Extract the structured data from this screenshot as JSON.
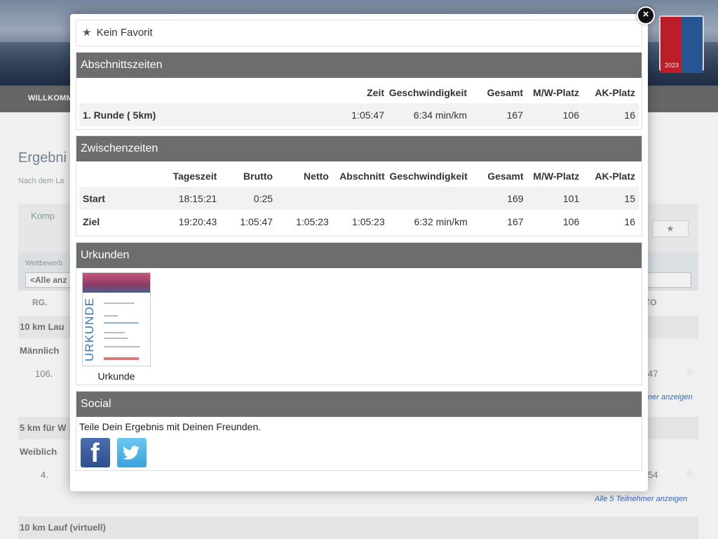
{
  "background": {
    "nav_label": "WILLKOMM",
    "page_title": "Ergebni",
    "page_subtitle": "Nach dem La",
    "komp_label": "Komp",
    "filter_label": "Wettbewerb",
    "filter_value": "<Alle anz",
    "col_rg": "RG.",
    "col_to": "TO",
    "group1": "10 km Lau",
    "group1_sub": "Männlich",
    "row1_rank": "106.",
    "row1_right": "47",
    "link1": "ner anzeigen",
    "group2": "5 km für W",
    "group2_sub": "Weiblich",
    "row2_rank": "4.",
    "row2_right": "54",
    "link2": "Alle 5 Teilnehmer anzeigen",
    "group3": "10 km Lauf (virtuell)",
    "logo_year": "2023"
  },
  "modal": {
    "favorite_label": "Kein Favorit",
    "close_label": "×",
    "split_times": {
      "title": "Abschnittszeiten",
      "headers": [
        "",
        "Zeit",
        "Geschwindigkeit",
        "Gesamt",
        "M/W-Platz",
        "AK-Platz"
      ],
      "rows": [
        [
          "1. Runde ( 5km)",
          "1:05:47",
          "6:34 min/km",
          "167",
          "106",
          "16"
        ]
      ]
    },
    "intermediate_times": {
      "title": "Zwischenzeiten",
      "headers": [
        "",
        "Tageszeit",
        "Brutto",
        "Netto",
        "Abschnitt",
        "Geschwindigkeit",
        "Gesamt",
        "M/W-Platz",
        "AK-Platz"
      ],
      "rows": [
        [
          "Start",
          "18:15:21",
          "0:25",
          "",
          "",
          "",
          "169",
          "101",
          "15"
        ],
        [
          "Ziel",
          "19:20:43",
          "1:05:47",
          "1:05:23",
          "1:05:23",
          "6:32 min/km",
          "167",
          "106",
          "16"
        ]
      ]
    },
    "certificates": {
      "title": "Urkunden",
      "image_word": "URKUNDE",
      "caption": "Urkunde"
    },
    "social": {
      "title": "Social",
      "text": "Teile Dein Ergebnis mit Deinen Freunden.",
      "icons": [
        "facebook-icon",
        "twitter-icon"
      ]
    }
  }
}
